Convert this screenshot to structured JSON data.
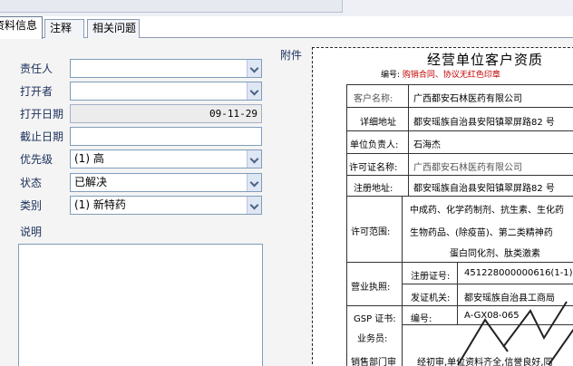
{
  "tabs": [
    {
      "label": "资料信息",
      "active": true
    },
    {
      "label": "注释",
      "active": false
    },
    {
      "label": "相关问题",
      "active": false
    }
  ],
  "form": {
    "owner": {
      "label": "责任人",
      "value": ""
    },
    "opener": {
      "label": "打开者",
      "value": ""
    },
    "open_date": {
      "label": "打开日期",
      "value": "09-11-29"
    },
    "due_date": {
      "label": "截止日期",
      "value": ""
    },
    "priority": {
      "label": "优先级",
      "value": "(1) 高"
    },
    "status": {
      "label": "状态",
      "value": "已解决"
    },
    "category": {
      "label": "类别",
      "value": "(1) 新特药"
    },
    "description": {
      "label": "说明",
      "value": ""
    }
  },
  "attachment": {
    "label": "附件"
  },
  "document": {
    "title": "经营单位客户资质",
    "sub_prefix": "编号:",
    "sub_red": "购销合同、协议无红色印章",
    "rows": {
      "customer_name": {
        "label": "客户名称:",
        "value": "广西都安石林医药有限公司"
      },
      "address": {
        "label": "详细地址",
        "value": "都安瑶族自治县安阳镇翠屏路82 号"
      },
      "leader": {
        "label": "单位负责人:",
        "value": "石海杰"
      },
      "license_name": {
        "label": "许可证名称:",
        "value": "广西都安石林医药有限公司"
      },
      "reg_address": {
        "label": "注册地址:",
        "value": "都安瑶族自治县安阳镇翠屏路82 号"
      },
      "scope": {
        "label": "许可范围:",
        "line1": "中成药、化学药制剂、抗生素、生化药",
        "line2": "生物药品、(除疫苗)、第二类精神药",
        "line3": "蛋白同化剂、肽类激素"
      },
      "business_license": {
        "label": "营业执照:",
        "reg_no_label": "注册证号:",
        "reg_no": "451228000000616(1-1)",
        "issuer_label": "发证机关:",
        "issuer": "都安瑶族自治县工商局"
      },
      "gsp": {
        "label": "GSP 证书:",
        "no_label": "编号:",
        "no": "A-GX08-065"
      },
      "salesperson": {
        "label": "业务员:"
      },
      "sales_dept": {
        "label": "销售部门审",
        "value": "经初审,单位资料齐全,信誉良好,同"
      }
    }
  }
}
